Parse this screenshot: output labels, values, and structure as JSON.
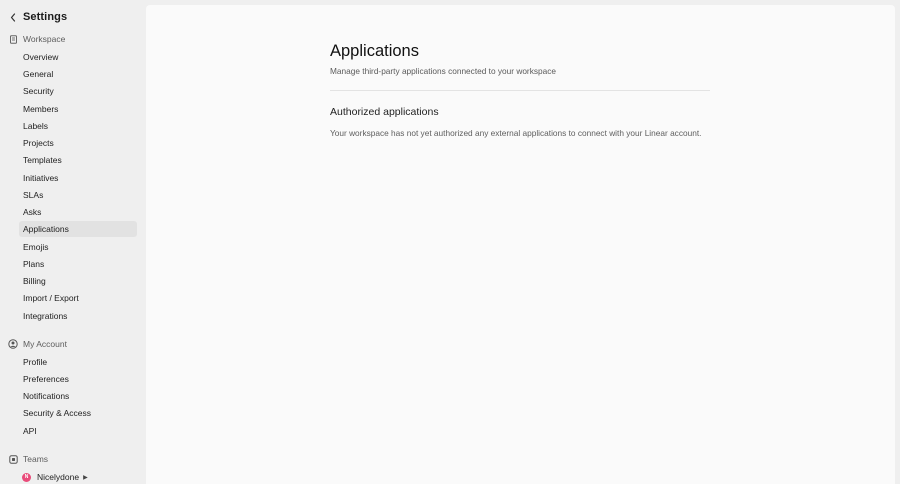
{
  "sidebar": {
    "title": "Settings",
    "workspace": {
      "label": "Workspace",
      "items": [
        {
          "label": "Overview"
        },
        {
          "label": "General"
        },
        {
          "label": "Security"
        },
        {
          "label": "Members"
        },
        {
          "label": "Labels"
        },
        {
          "label": "Projects"
        },
        {
          "label": "Templates"
        },
        {
          "label": "Initiatives"
        },
        {
          "label": "SLAs"
        },
        {
          "label": "Asks"
        },
        {
          "label": "Applications",
          "active": true
        },
        {
          "label": "Emojis"
        },
        {
          "label": "Plans"
        },
        {
          "label": "Billing"
        },
        {
          "label": "Import / Export"
        },
        {
          "label": "Integrations"
        }
      ]
    },
    "account": {
      "label": "My Account",
      "items": [
        {
          "label": "Profile"
        },
        {
          "label": "Preferences"
        },
        {
          "label": "Notifications"
        },
        {
          "label": "Security & Access"
        },
        {
          "label": "API"
        }
      ]
    },
    "teams": {
      "label": "Teams",
      "items": [
        {
          "label": "Nicelydone",
          "avatar_letter": "N",
          "avatar_color": "#e94b7a"
        }
      ]
    }
  },
  "main": {
    "title": "Applications",
    "subtitle": "Manage third-party applications connected to your workspace",
    "authorized": {
      "title": "Authorized applications",
      "empty_text": "Your workspace has not yet authorized any external applications to connect with your Linear account."
    }
  },
  "colors": {
    "sidebar_bg": "#efefef",
    "main_bg": "#fafafa",
    "active_item_bg": "#e2e2e2",
    "team_avatar": "#e94b7a"
  }
}
